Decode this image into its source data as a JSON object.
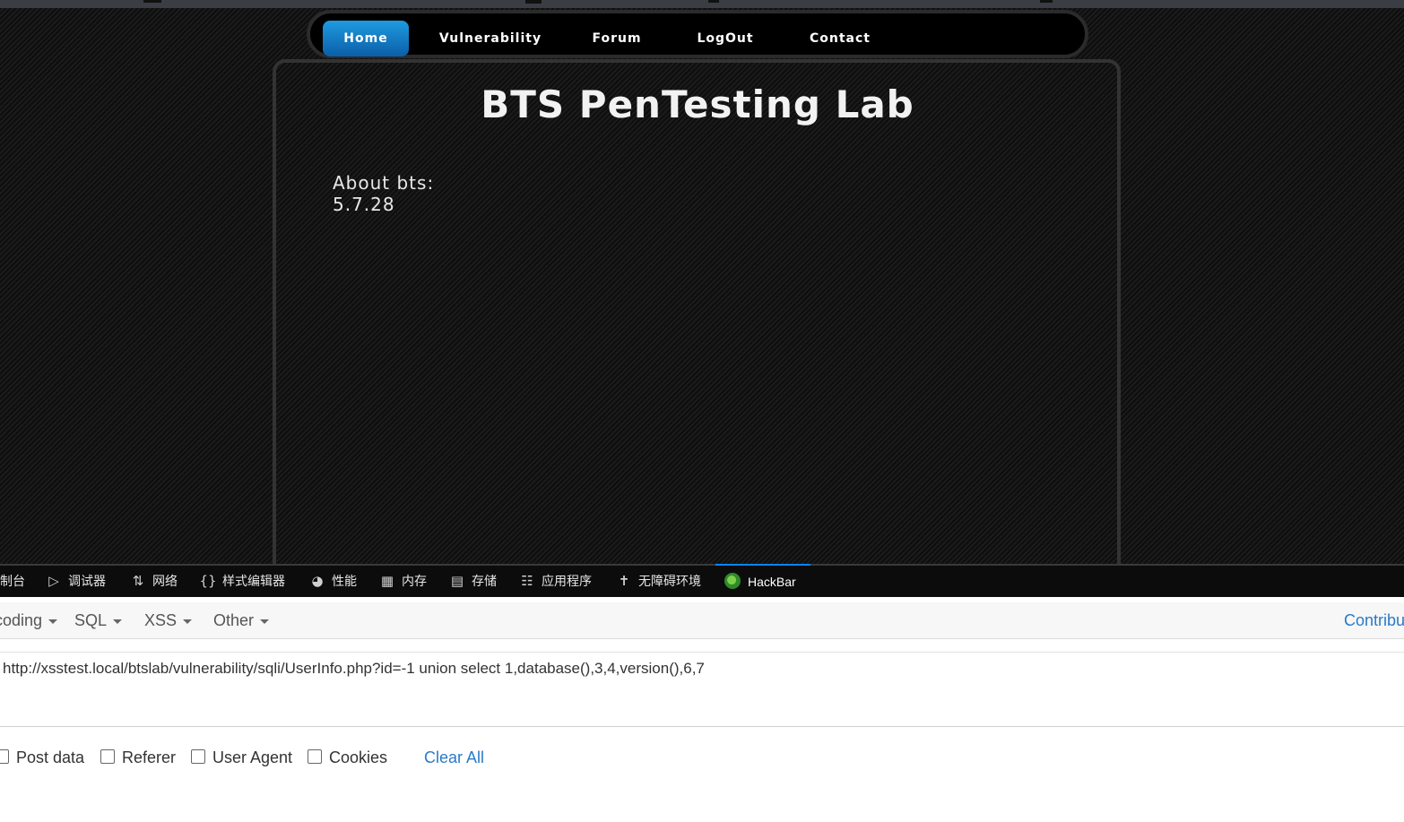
{
  "site": {
    "nav": [
      {
        "label": "Home",
        "active": true
      },
      {
        "label": "Vulnerability"
      },
      {
        "label": "Forum"
      },
      {
        "label": "LogOut"
      },
      {
        "label": "Contact"
      }
    ],
    "title": "BTS PenTesting Lab",
    "about_label": "About bts:",
    "about_value": "5.7.28"
  },
  "devtools": {
    "tabs": [
      {
        "label": "控制台",
        "icon": "console-icon"
      },
      {
        "label": "调试器",
        "icon": "debugger-icon"
      },
      {
        "label": "网络",
        "icon": "network-icon"
      },
      {
        "label": "样式编辑器",
        "icon": "style-editor-icon"
      },
      {
        "label": "性能",
        "icon": "performance-icon"
      },
      {
        "label": "内存",
        "icon": "memory-icon"
      },
      {
        "label": "存储",
        "icon": "storage-icon"
      },
      {
        "label": "应用程序",
        "icon": "application-icon"
      },
      {
        "label": "无障碍环境",
        "icon": "accessibility-icon"
      },
      {
        "label": "HackBar",
        "icon": "hackbar-logo-icon",
        "active": true
      }
    ]
  },
  "hackbar": {
    "menu": [
      {
        "label": "Encoding"
      },
      {
        "label": "SQL"
      },
      {
        "label": "XSS"
      },
      {
        "label": "Other"
      }
    ],
    "contribute": "Contribute",
    "url": "http://xsstest.local/btslab/vulnerability/sqli/UserInfo.php?id=-1 union select 1,database(),3,4,version(),6,7",
    "options": [
      {
        "label": "Post data",
        "checked": false
      },
      {
        "label": "Referer",
        "checked": false
      },
      {
        "label": "User Agent",
        "checked": false
      },
      {
        "label": "Cookies",
        "checked": false
      }
    ],
    "clear_all": "Clear All"
  },
  "colors": {
    "accent": "#0b84d8",
    "link": "#2a7ac8",
    "devtools_bg": "#0c0c0d"
  }
}
